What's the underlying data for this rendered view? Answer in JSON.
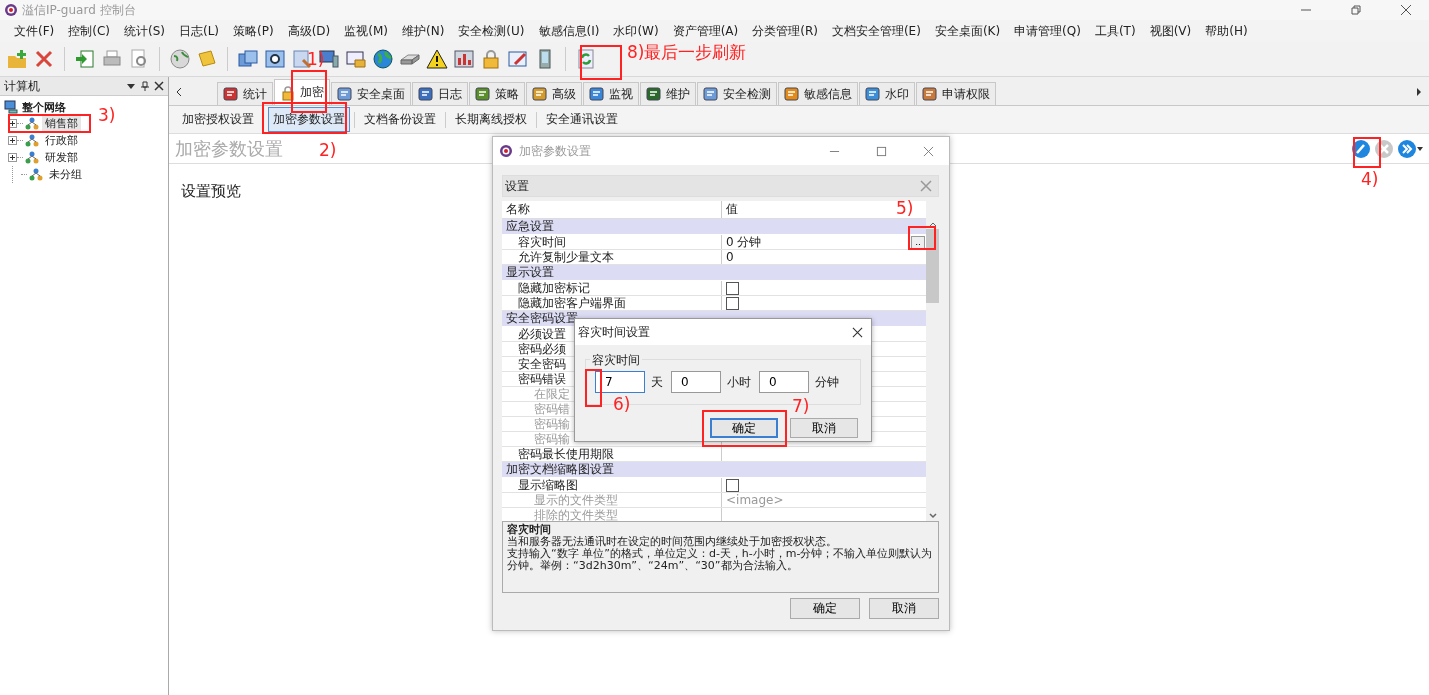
{
  "window": {
    "title": "溢信IP-guard 控制台"
  },
  "menu": [
    "文件(F)",
    "控制(C)",
    "统计(S)",
    "日志(L)",
    "策略(P)",
    "高级(D)",
    "监视(M)",
    "维护(N)",
    "安全检测(U)",
    "敏感信息(I)",
    "水印(W)",
    "资产管理(A)",
    "分类管理(R)",
    "文档安全管理(E)",
    "安全桌面(K)",
    "申请管理(Q)",
    "工具(T)",
    "视图(V)",
    "帮助(H)"
  ],
  "left_panel": {
    "title": "计算机",
    "tree": {
      "label": "整个网络",
      "children": [
        {
          "label": "销售部",
          "expandable": true,
          "selected": true
        },
        {
          "label": "行政部",
          "expandable": true,
          "selected": false
        },
        {
          "label": "研发部",
          "expandable": true,
          "selected": false
        },
        {
          "label": "未分组",
          "expandable": false,
          "selected": false
        }
      ]
    }
  },
  "tabs": [
    {
      "label": "统计",
      "selected": false
    },
    {
      "label": "加密",
      "selected": true
    },
    {
      "label": "安全桌面",
      "selected": false
    },
    {
      "label": "日志",
      "selected": false
    },
    {
      "label": "策略",
      "selected": false
    },
    {
      "label": "高级",
      "selected": false
    },
    {
      "label": "监视",
      "selected": false
    },
    {
      "label": "维护",
      "selected": false
    },
    {
      "label": "安全检测",
      "selected": false
    },
    {
      "label": "敏感信息",
      "selected": false
    },
    {
      "label": "水印",
      "selected": false
    },
    {
      "label": "申请权限",
      "selected": false
    }
  ],
  "subtabs": [
    {
      "label": "加密授权设置",
      "selected": false
    },
    {
      "label": "加密参数设置",
      "selected": true
    },
    {
      "label": "文档备份设置",
      "selected": false
    },
    {
      "label": "长期离线授权",
      "selected": false
    },
    {
      "label": "安全通讯设置",
      "selected": false
    }
  ],
  "content": {
    "title": "加密参数设置",
    "preview_label": "设置预览"
  },
  "dialog": {
    "title": "加密参数设置",
    "panel_title": "设置",
    "columns": [
      "名称",
      "值"
    ],
    "groups": [
      {
        "name": "应急设置",
        "children": [
          {
            "name": "容灾时间",
            "value": "0 分钟",
            "button_label": "..",
            "disabled": false
          },
          {
            "name": "允许复制少量文本",
            "value": "0",
            "disabled": false
          }
        ]
      },
      {
        "name": "显示设置",
        "children": [
          {
            "name": "隐藏加密标记",
            "checked": false,
            "disabled": false
          },
          {
            "name": "隐藏加密客户端界面",
            "checked": false,
            "disabled": false
          }
        ]
      },
      {
        "name": "安全密码设置",
        "children": [
          {
            "name": "必须设置",
            "disabled": false
          },
          {
            "name": "密码必须",
            "disabled": false
          },
          {
            "name": "安全密码",
            "disabled": false
          },
          {
            "name": "密码错误",
            "disabled": false,
            "children": [
              {
                "name": "在限定",
                "disabled": true
              },
              {
                "name": "密码错",
                "disabled": true
              },
              {
                "name": "密码输",
                "disabled": true
              },
              {
                "name": "密码输",
                "disabled": true
              }
            ]
          },
          {
            "name": "密码最长使用期限",
            "disabled": false
          }
        ]
      },
      {
        "name": "加密文档缩略图设置",
        "children": [
          {
            "name": "显示缩略图",
            "checked": false,
            "disabled": false,
            "children": [
              {
                "name": "显示的文件类型",
                "value": "<image>",
                "disabled": true
              },
              {
                "name": "排除的文件类型",
                "disabled": true
              }
            ]
          }
        ]
      }
    ],
    "description": {
      "title": "容灾时间",
      "lines": [
        "当和服务器无法通讯时在设定的时间范围内继续处于加密授权状态。",
        "支持输入“数字 单位”的格式，单位定义：d-天，h-小时，m-分钟；不输入单位则默认为分钟。举例：“3d2h30m”、“24m”、“30”都为合法输入。"
      ]
    },
    "buttons": [
      "确定",
      "取消"
    ]
  },
  "sub_dialog": {
    "title": "容灾时间设置",
    "group_label": "容灾时间",
    "fields": [
      {
        "value": "7",
        "unit": "天",
        "focused": true
      },
      {
        "value": "0",
        "unit": "小时",
        "focused": false
      },
      {
        "value": "0",
        "unit": "分钟",
        "focused": false
      }
    ],
    "buttons": [
      {
        "label": "确定",
        "default": true
      },
      {
        "label": "取消",
        "default": false
      }
    ]
  },
  "annotations": [
    "1)",
    "2)",
    "3)",
    "4)",
    "5)",
    "6)",
    "7)",
    "8)最后一步刷新"
  ]
}
